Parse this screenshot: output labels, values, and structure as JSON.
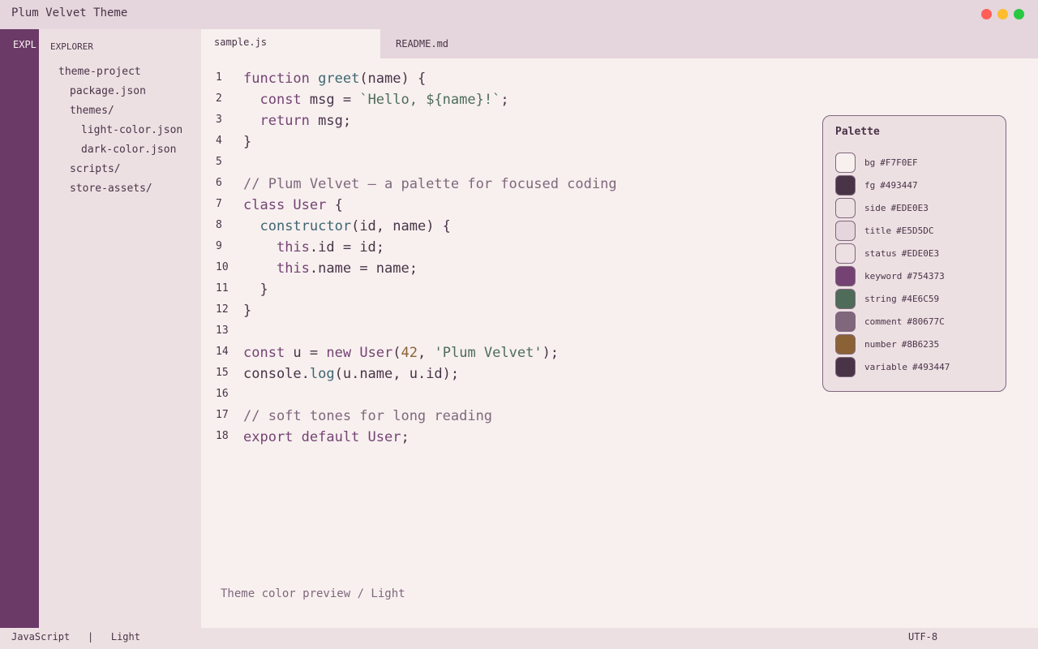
{
  "window": {
    "title": "Plum Velvet Theme",
    "buttons": {
      "close_color": "#FF5F57",
      "minimize_color": "#FEBC2E",
      "maximize_color": "#28C840"
    }
  },
  "activity_bar": {
    "label": "EXPL",
    "color": "#6B3A67"
  },
  "sidebar": {
    "title": "EXPLORER",
    "items": [
      {
        "label": "theme-project",
        "depth": 0
      },
      {
        "label": "package.json",
        "depth": 1
      },
      {
        "label": "themes/",
        "depth": 1
      },
      {
        "label": "light-color.json",
        "depth": 2
      },
      {
        "label": "dark-color.json",
        "depth": 2
      },
      {
        "label": "scripts/",
        "depth": 1
      },
      {
        "label": "store-assets/",
        "depth": 1
      }
    ]
  },
  "tabs": [
    {
      "label": "sample.js",
      "active": true
    },
    {
      "label": "README.md",
      "active": false
    }
  ],
  "editor": {
    "lines": [
      {
        "n": "1",
        "tokens": [
          {
            "t": "kw",
            "v": "function "
          },
          {
            "t": "fn",
            "v": "greet"
          },
          {
            "t": "",
            "v": "(name) {"
          }
        ]
      },
      {
        "n": "2",
        "tokens": [
          {
            "t": "",
            "v": "  "
          },
          {
            "t": "kw",
            "v": "const"
          },
          {
            "t": "",
            "v": " msg = "
          },
          {
            "t": "str",
            "v": "`Hello, ${name}!`"
          },
          {
            "t": "",
            "v": ";"
          }
        ]
      },
      {
        "n": "3",
        "tokens": [
          {
            "t": "",
            "v": "  "
          },
          {
            "t": "kw",
            "v": "return"
          },
          {
            "t": "",
            "v": " msg;"
          }
        ]
      },
      {
        "n": "4",
        "tokens": [
          {
            "t": "",
            "v": "}"
          }
        ]
      },
      {
        "n": "5",
        "tokens": []
      },
      {
        "n": "6",
        "tokens": [
          {
            "t": "cm",
            "v": "// Plum Velvet — a palette for focused coding"
          }
        ]
      },
      {
        "n": "7",
        "tokens": [
          {
            "t": "kw",
            "v": "class "
          },
          {
            "t": "kw",
            "v": "User"
          },
          {
            "t": "",
            "v": " {"
          }
        ]
      },
      {
        "n": "8",
        "tokens": [
          {
            "t": "",
            "v": "  "
          },
          {
            "t": "fn",
            "v": "constructor"
          },
          {
            "t": "",
            "v": "(id, name) {"
          }
        ]
      },
      {
        "n": "9",
        "tokens": [
          {
            "t": "",
            "v": "    "
          },
          {
            "t": "kw",
            "v": "this"
          },
          {
            "t": "",
            "v": ".id = id;"
          }
        ]
      },
      {
        "n": "10",
        "tokens": [
          {
            "t": "",
            "v": "    "
          },
          {
            "t": "kw",
            "v": "this"
          },
          {
            "t": "",
            "v": ".name = name;"
          }
        ]
      },
      {
        "n": "11",
        "tokens": [
          {
            "t": "",
            "v": "  }"
          }
        ]
      },
      {
        "n": "12",
        "tokens": [
          {
            "t": "",
            "v": "}"
          }
        ]
      },
      {
        "n": "13",
        "tokens": []
      },
      {
        "n": "14",
        "tokens": [
          {
            "t": "kw",
            "v": "const"
          },
          {
            "t": "",
            "v": " u = "
          },
          {
            "t": "kw",
            "v": "new "
          },
          {
            "t": "kw",
            "v": "User"
          },
          {
            "t": "",
            "v": "("
          },
          {
            "t": "num",
            "v": "42"
          },
          {
            "t": "",
            "v": ", "
          },
          {
            "t": "str",
            "v": "'Plum Velvet'"
          },
          {
            "t": "",
            "v": ");"
          }
        ]
      },
      {
        "n": "15",
        "tokens": [
          {
            "t": "",
            "v": "console."
          },
          {
            "t": "fn",
            "v": "log"
          },
          {
            "t": "",
            "v": "(u.name, u.id);"
          }
        ]
      },
      {
        "n": "16",
        "tokens": []
      },
      {
        "n": "17",
        "tokens": [
          {
            "t": "cm",
            "v": "// soft tones for long reading"
          }
        ]
      },
      {
        "n": "18",
        "tokens": [
          {
            "t": "kw",
            "v": "export default "
          },
          {
            "t": "kw",
            "v": "User"
          },
          {
            "t": "",
            "v": ";"
          }
        ]
      }
    ],
    "preview_note": "Theme color preview / Light"
  },
  "palette": {
    "title": "Palette",
    "swatches": [
      {
        "name": "bg",
        "hex": "#F7F0EF"
      },
      {
        "name": "fg",
        "hex": "#493447"
      },
      {
        "name": "side",
        "hex": "#EDE0E3"
      },
      {
        "name": "title",
        "hex": "#E5D5DC"
      },
      {
        "name": "status",
        "hex": "#EDE0E3"
      },
      {
        "name": "keyword",
        "hex": "#754373"
      },
      {
        "name": "string",
        "hex": "#4E6C59"
      },
      {
        "name": "comment",
        "hex": "#80677C"
      },
      {
        "name": "number",
        "hex": "#8B6235"
      },
      {
        "name": "variable",
        "hex": "#493447"
      }
    ]
  },
  "statusbar": {
    "language": "JavaScript",
    "separator": "|",
    "mode": "Light",
    "encoding": "UTF-8"
  }
}
